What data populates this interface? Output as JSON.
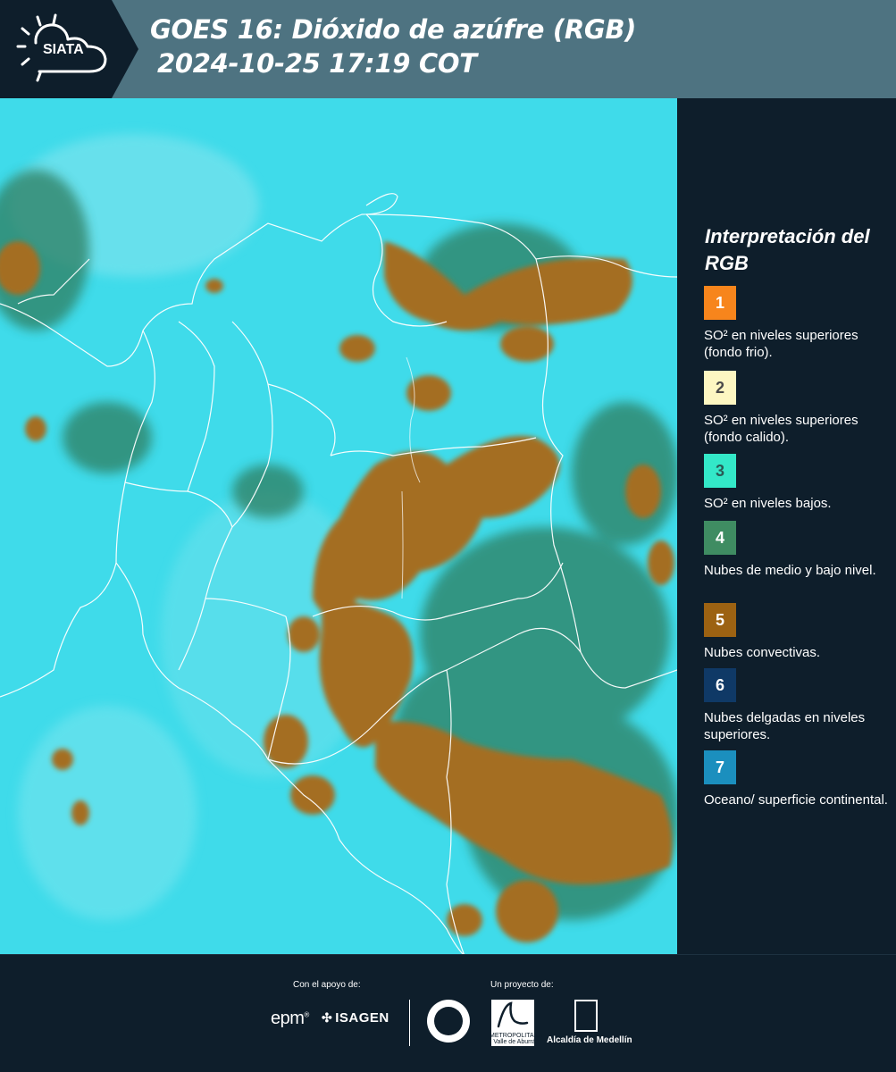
{
  "header": {
    "logo_text": "SIATA",
    "title_line1": "GOES 16: Dióxido de azúfre (RGB)",
    "title_line2": "2024-10-25 17:19 COT",
    "bg_color": "#4e7381",
    "logo_bg_color": "#0e1e2b"
  },
  "map": {
    "background_color": "#3fdbea",
    "cloud_color": "#a46e24",
    "mid_cloud_color": "#2f7e60",
    "border_color": "#ffffff"
  },
  "legend": {
    "title": "Interpretación del RGB",
    "items": [
      {
        "number": "1",
        "color": "#f7851c",
        "number_color": "#ffffff",
        "text": "SO² en niveles superiores (fondo frio)."
      },
      {
        "number": "2",
        "color": "#fdf7c2",
        "number_color": "#4a4a4a",
        "text": "SO² en niveles superiores (fondo calido)."
      },
      {
        "number": "3",
        "color": "#33e8c8",
        "number_color": "#2a5a55",
        "text": "SO² en niveles bajos."
      },
      {
        "number": "4",
        "color": "#3f8c62",
        "number_color": "#ffffff",
        "text": "Nubes de medio y bajo nivel."
      },
      {
        "number": "5",
        "color": "#9c6212",
        "number_color": "#ffffff",
        "text": "Nubes convectivas."
      },
      {
        "number": "6",
        "color": "#0f3966",
        "number_color": "#ffffff",
        "text": "Nubes delgadas en niveles superiores."
      },
      {
        "number": "7",
        "color": "#1b8fbe",
        "number_color": "#ffffff",
        "text": "Oceano/ superficie continental."
      }
    ]
  },
  "footer": {
    "support_label": "Con el apoyo de:",
    "project_label": "Un proyecto de:",
    "sponsor1": "epm",
    "sponsor1_mark": "®",
    "sponsor2": "ISAGEN",
    "partner_area": "METROPOLITANA Valle de Aburrá",
    "partner_medellin": "Alcaldía de Medellín"
  }
}
